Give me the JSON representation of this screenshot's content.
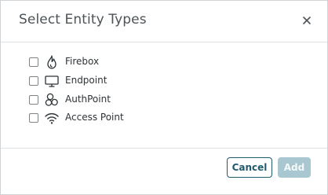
{
  "dialog": {
    "title": "Select Entity Types",
    "close_icon": "close-icon"
  },
  "entities": [
    {
      "label": "Firebox",
      "icon": "firebox-flame-icon",
      "checked": false
    },
    {
      "label": "Endpoint",
      "icon": "endpoint-monitor-icon",
      "checked": false
    },
    {
      "label": "AuthPoint",
      "icon": "authpoint-icon",
      "checked": false
    },
    {
      "label": "Access Point",
      "icon": "wifi-icon",
      "checked": false
    }
  ],
  "footer": {
    "cancel_label": "Cancel",
    "add_label": "Add"
  },
  "colors": {
    "primary": "#1e5c6e",
    "primary_disabled": "#a9c7d0",
    "text": "#2e3336"
  }
}
